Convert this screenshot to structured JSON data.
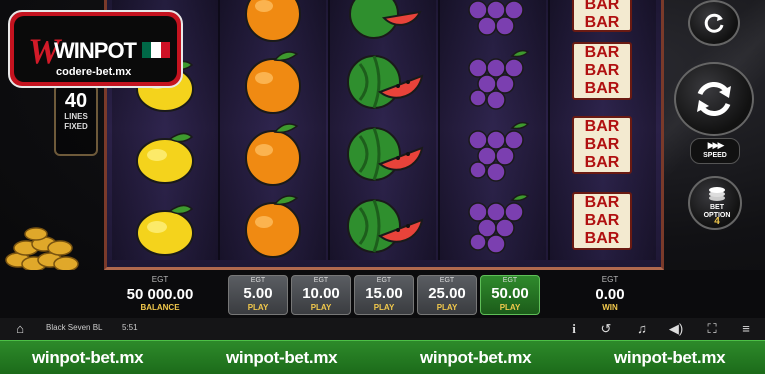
{
  "branding": {
    "logo_text": "WINPOT",
    "logo_subtext": "codere-bet.mx",
    "flag_colors": [
      "#006847",
      "#ffffff",
      "#ce1126"
    ]
  },
  "lines_indicator": {
    "value": "40",
    "label_line1": "LINES",
    "label_line2": "FIXED"
  },
  "reels": [
    {
      "symbol": "lemon",
      "rows": [
        "lemon",
        "lemon",
        "lemon"
      ]
    },
    {
      "symbol": "orange",
      "rows": [
        "orange",
        "orange",
        "orange",
        "orange"
      ]
    },
    {
      "symbol": "watermelon",
      "rows": [
        "watermelon",
        "watermelon",
        "watermelon",
        "watermelon"
      ]
    },
    {
      "symbol": "grapes",
      "rows": [
        "grapes",
        "grapes",
        "grapes",
        "grapes"
      ]
    },
    {
      "symbol": "bar",
      "label": "BAR",
      "rows": [
        "bar",
        "bar",
        "bar",
        "bar"
      ]
    }
  ],
  "controls": {
    "autoplay_icon": "refresh-icon",
    "spin_icon": "spin-icon",
    "speed_label": "SPEED",
    "bet_option_label_1": "BET",
    "bet_option_label_2": "OPTION",
    "bet_option_value": "4"
  },
  "panel": {
    "balance": {
      "egt": "EGT",
      "value": "50 000.00",
      "label": "BALANCE"
    },
    "bets": [
      {
        "egt": "EGT",
        "value": "5.00",
        "label": "PLAY",
        "selected": false
      },
      {
        "egt": "EGT",
        "value": "10.00",
        "label": "PLAY",
        "selected": false
      },
      {
        "egt": "EGT",
        "value": "15.00",
        "label": "PLAY",
        "selected": false
      },
      {
        "egt": "EGT",
        "value": "25.00",
        "label": "PLAY",
        "selected": false
      },
      {
        "egt": "EGT",
        "value": "50.00",
        "label": "PLAY",
        "selected": true
      }
    ],
    "win": {
      "egt": "EGT",
      "value": "0.00",
      "label": "WIN"
    }
  },
  "status_bar": {
    "game_name": "Black Seven BL",
    "time": "5:51",
    "icons": [
      "home-icon",
      "info-icon",
      "history-icon",
      "music-icon",
      "sound-icon",
      "fullscreen-icon",
      "menu-icon"
    ]
  },
  "footer": {
    "watermarks": [
      "winpot-bet.mx",
      "winpot-bet.mx",
      "winpot-bet.mx",
      "winpot-bet.mx"
    ]
  },
  "colors": {
    "accent_gold": "#f2c94c",
    "selected_green": "#2f8a2c",
    "brand_red": "#c4131f"
  }
}
